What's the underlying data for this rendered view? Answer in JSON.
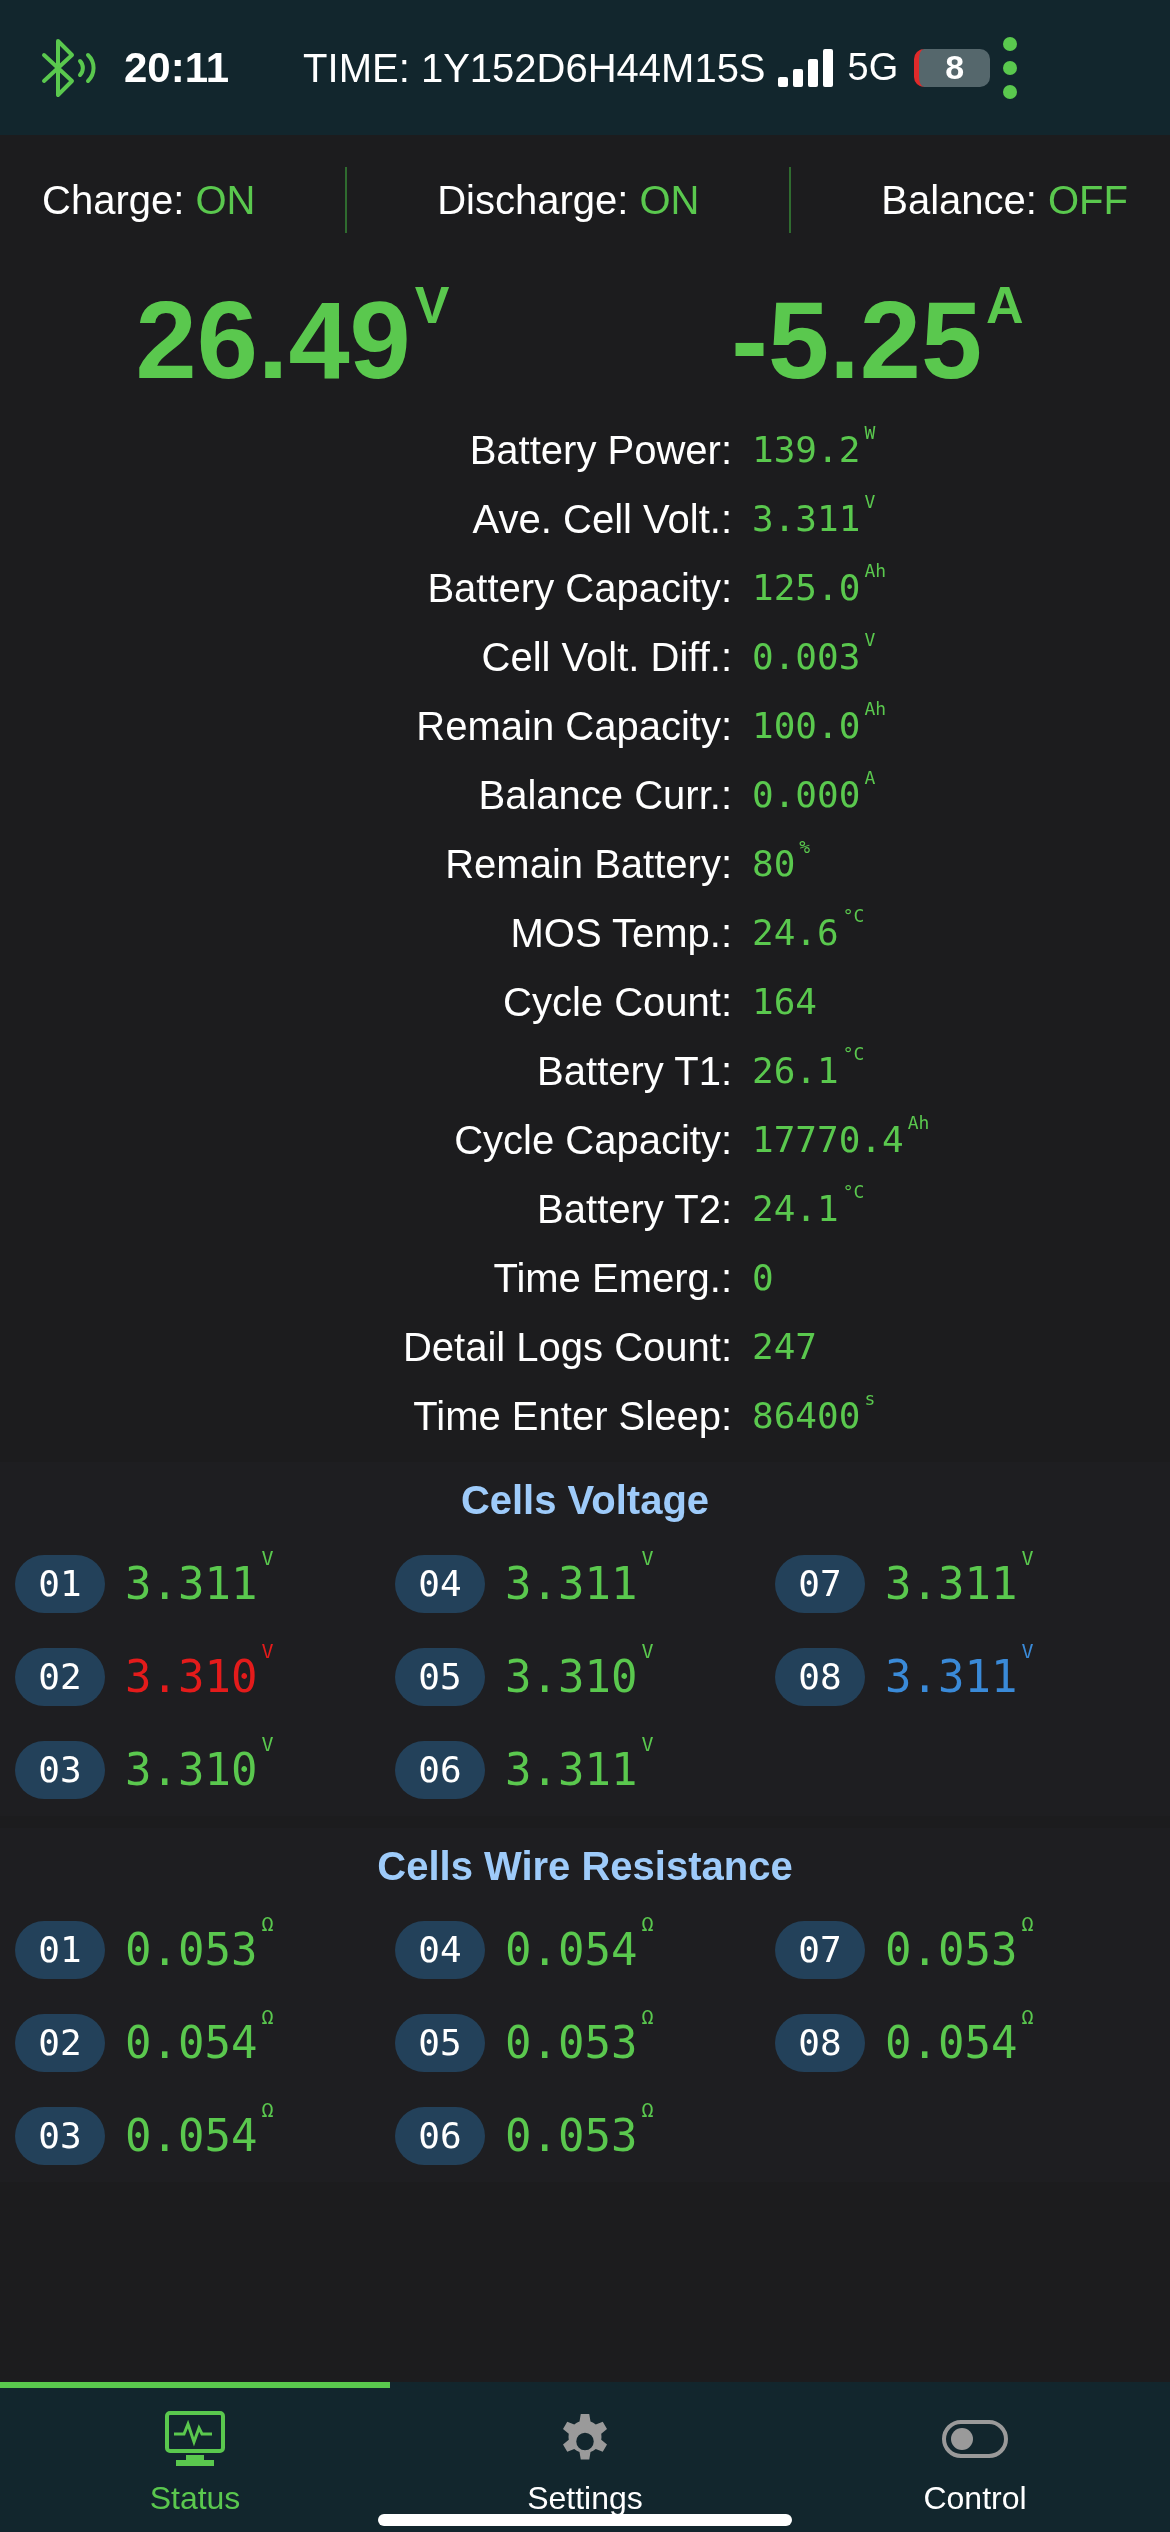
{
  "status_bar": {
    "time": "20:11",
    "runtime": "TIME: 1Y152D6H44M15S",
    "network": "5G",
    "battery": "8"
  },
  "switches": [
    {
      "label": "Charge:",
      "state": "ON"
    },
    {
      "label": "Discharge:",
      "state": "ON"
    },
    {
      "label": "Balance:",
      "state": "OFF"
    }
  ],
  "voltage": {
    "value": "26.49",
    "unit": "V"
  },
  "current": {
    "value": "-5.25",
    "unit": "A"
  },
  "stats": [
    {
      "label": "Battery Power:",
      "value": "139.2",
      "unit": "W"
    },
    {
      "label": "Ave. Cell Volt.:",
      "value": "3.311",
      "unit": "V"
    },
    {
      "label": "Battery Capacity:",
      "value": "125.0",
      "unit": "Ah"
    },
    {
      "label": "Cell Volt. Diff.:",
      "value": "0.003",
      "unit": "V"
    },
    {
      "label": "Remain Capacity:",
      "value": "100.0",
      "unit": "Ah"
    },
    {
      "label": "Balance Curr.:",
      "value": "0.000",
      "unit": "A"
    },
    {
      "label": "Remain Battery:",
      "value": "80",
      "unit": "%"
    },
    {
      "label": "MOS Temp.:",
      "value": "24.6",
      "unit": "°C"
    },
    {
      "label": "Cycle Count:",
      "value": "164"
    },
    {
      "label": "Battery T1:",
      "value": "26.1",
      "unit": "°C"
    },
    {
      "label": "Cycle Capacity:",
      "value": "17770.4",
      "unit": "Ah"
    },
    {
      "label": "Battery T2:",
      "value": "24.1",
      "unit": "°C"
    },
    {
      "label": "Time Emerg.:",
      "value": "0"
    },
    {
      "label": "Detail Logs Count:",
      "value": "247"
    },
    {
      "label": "Time Enter Sleep:",
      "value": "86400",
      "unit": "s"
    }
  ],
  "sections": [
    {
      "title": "Cells Voltage",
      "cells": [
        {
          "id": "01",
          "value": "3.311",
          "unit": "V",
          "color": "#5ac84e"
        },
        {
          "id": "02",
          "value": "3.310",
          "unit": "V",
          "color": "#e41b1b"
        },
        {
          "id": "03",
          "value": "3.310",
          "unit": "V",
          "color": "#5ac84e"
        },
        {
          "id": "04",
          "value": "3.311",
          "unit": "V",
          "color": "#5ac84e"
        },
        {
          "id": "05",
          "value": "3.310",
          "unit": "V",
          "color": "#5ac84e"
        },
        {
          "id": "06",
          "value": "3.311",
          "unit": "V",
          "color": "#5ac84e"
        },
        {
          "id": "07",
          "value": "3.311",
          "unit": "V",
          "color": "#5ac84e"
        },
        {
          "id": "08",
          "value": "3.311",
          "unit": "V",
          "color": "#3a8ad8"
        }
      ]
    },
    {
      "title": "Cells Wire Resistance",
      "cells": [
        {
          "id": "01",
          "value": "0.053",
          "unit": "Ω",
          "color": "#5ac84e"
        },
        {
          "id": "02",
          "value": "0.054",
          "unit": "Ω",
          "color": "#5ac84e"
        },
        {
          "id": "03",
          "value": "0.054",
          "unit": "Ω",
          "color": "#5ac84e"
        },
        {
          "id": "04",
          "value": "0.054",
          "unit": "Ω",
          "color": "#5ac84e"
        },
        {
          "id": "05",
          "value": "0.053",
          "unit": "Ω",
          "color": "#5ac84e"
        },
        {
          "id": "06",
          "value": "0.053",
          "unit": "Ω",
          "color": "#5ac84e"
        },
        {
          "id": "07",
          "value": "0.053",
          "unit": "Ω",
          "color": "#5ac84e"
        },
        {
          "id": "08",
          "value": "0.054",
          "unit": "Ω",
          "color": "#5ac84e"
        }
      ]
    }
  ],
  "tabs": [
    {
      "label": "Status",
      "kind": "status",
      "selected": true
    },
    {
      "label": "Settings",
      "kind": "settings",
      "selected": false
    },
    {
      "label": "Control",
      "kind": "control",
      "selected": false
    }
  ]
}
